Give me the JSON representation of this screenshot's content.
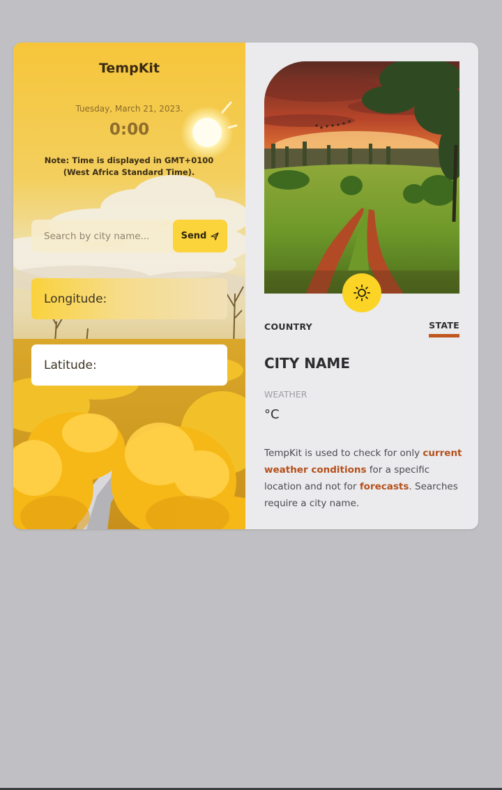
{
  "left_panel": {
    "app_title": "TempKit",
    "date": "Tuesday, March 21, 2023.",
    "time": "0:00",
    "timezone_note": "Note: Time is displayed in GMT+0100 (West Africa Standard Time).",
    "search": {
      "placeholder": "Search by city name...",
      "value": "",
      "button_label": "Send",
      "button_icon": "send-icon"
    },
    "longitude_label": "Longitude:",
    "latitude_label": "Latitude:"
  },
  "right_panel": {
    "weather_icon": "sun-icon",
    "country_label": "COUNTRY",
    "state_label": "STATE",
    "city_name": "CITY NAME",
    "weather_label": "WEATHER",
    "temperature": "°C",
    "description": {
      "part1": "TempKit is used to check for only ",
      "highlight1": "current weather conditions",
      "part2": " for a specific location and not for ",
      "highlight2": "forecasts",
      "part3": ". Searches require a city name."
    }
  },
  "colors": {
    "accent": "#fbd33a",
    "highlight": "#b5501a",
    "panel_bg": "#ebebee",
    "page_bg": "#c0c0c4"
  }
}
